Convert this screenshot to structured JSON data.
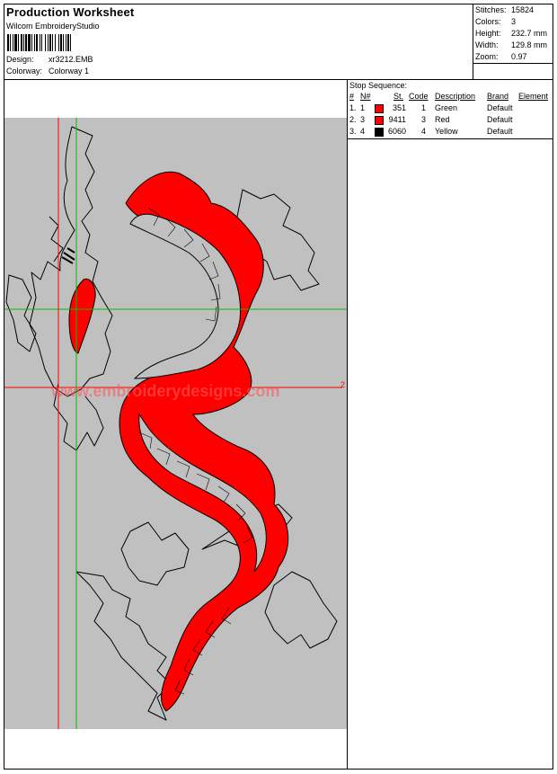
{
  "header": {
    "title": "Production Worksheet",
    "software": "Wilcom EmbroideryStudio",
    "design_label": "Design:",
    "design_value": "xr3212.EMB",
    "colorway_label": "Colorway:",
    "colorway_value": "Colorway 1"
  },
  "stats": {
    "stitches_label": "Stitches:",
    "stitches_value": "15824",
    "colors_label": "Colors:",
    "colors_value": "3",
    "height_label": "Height:",
    "height_value": "232.7 mm",
    "width_label": "Width:",
    "width_value": "129.8 mm",
    "zoom_label": "Zoom:",
    "zoom_value": "0.97"
  },
  "design": {
    "watermark": "www.embroiderydesigns.com",
    "marker_label": "2",
    "fill_color": "#ff0000",
    "background_color": "#c0c0c0",
    "guide_green": "#00c000",
    "guide_red": "#ff0000"
  },
  "stop_sequence": {
    "title": "Stop Sequence:",
    "headers": {
      "num": "#",
      "needle": "N#",
      "stitches": "St.",
      "code": "Code",
      "description": "Description",
      "brand": "Brand",
      "element": "Element"
    },
    "rows": [
      {
        "num": "1.",
        "needle": "1",
        "color": "#ff0000",
        "stitches": "351",
        "code": "1",
        "description": "Green",
        "brand": "Default"
      },
      {
        "num": "2.",
        "needle": "3",
        "color": "#ff0000",
        "stitches": "9411",
        "code": "3",
        "description": "Red",
        "brand": "Default"
      },
      {
        "num": "3.",
        "needle": "4",
        "color": "#000000",
        "stitches": "6060",
        "code": "4",
        "description": "Yellow",
        "brand": "Default"
      }
    ]
  }
}
